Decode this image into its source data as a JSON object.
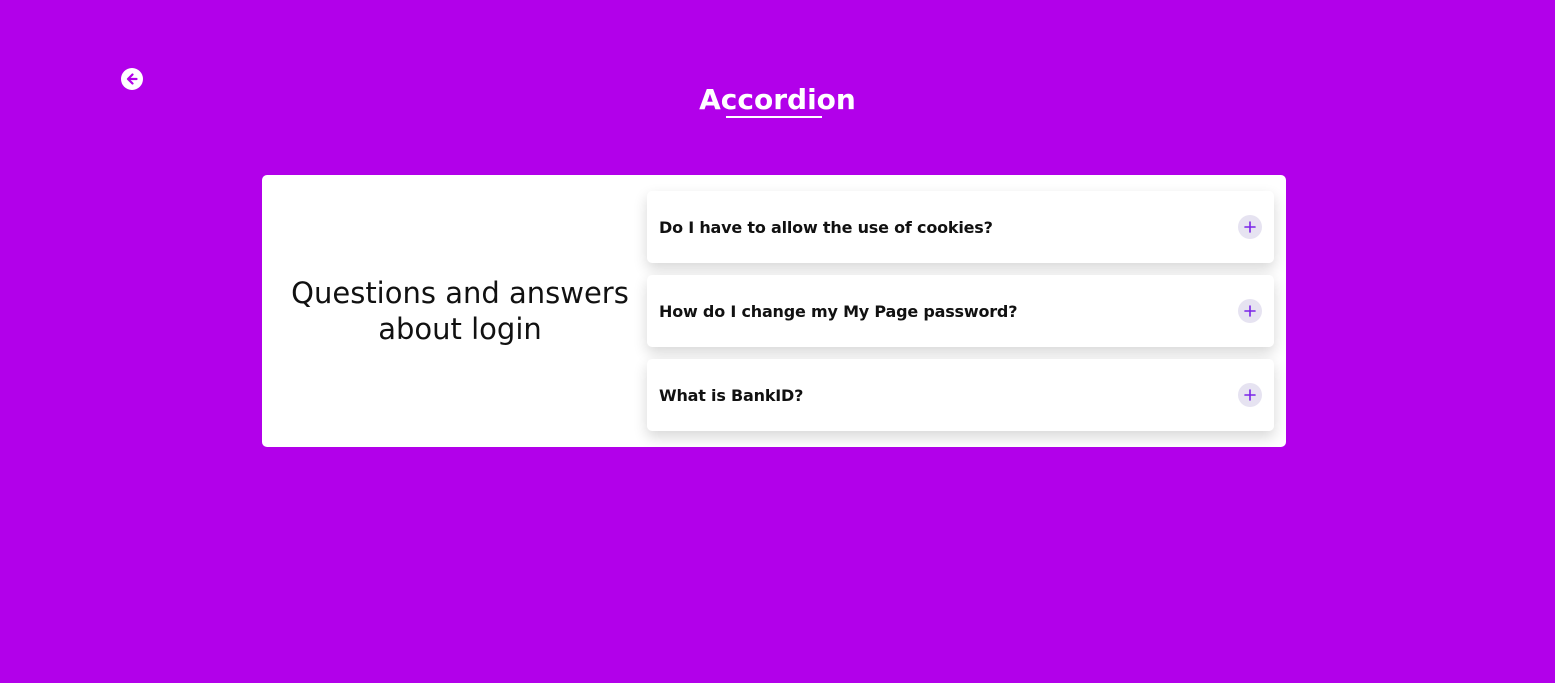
{
  "header": {
    "back_icon": "arrow-left-circle-icon",
    "title": "Accordion"
  },
  "colors": {
    "background": "#b200ea",
    "card": "#ffffff",
    "accent": "#7a24e8",
    "toggle_bg": "#e6e3f1"
  },
  "card": {
    "intro": "Questions and answers about login",
    "items": [
      {
        "question": "Do I have to allow the use of cookies?",
        "icon": "plus-icon"
      },
      {
        "question": "How do I change my My Page password?",
        "icon": "plus-icon"
      },
      {
        "question": "What is BankID?",
        "icon": "plus-icon"
      }
    ]
  }
}
